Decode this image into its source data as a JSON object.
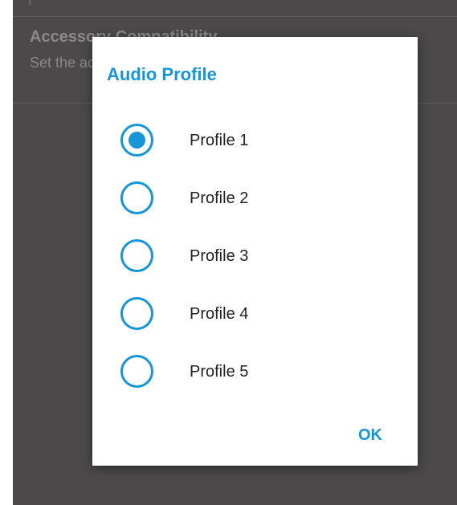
{
  "background_screen": {
    "preference_title": "Accessory Compatibility",
    "preference_summary": "Set the accessory compatibility mode"
  },
  "dialog": {
    "title": "Audio Profile",
    "options": [
      {
        "label": "Profile 1",
        "selected": true
      },
      {
        "label": "Profile 2",
        "selected": false
      },
      {
        "label": "Profile 3",
        "selected": false
      },
      {
        "label": "Profile 4",
        "selected": false
      },
      {
        "label": "Profile 5",
        "selected": false
      }
    ],
    "ok_label": "OK"
  },
  "colors": {
    "accent": "#1496d8",
    "scrim_background": "#4b4949",
    "dialog_background": "#ffffff",
    "option_text": "#222222"
  }
}
